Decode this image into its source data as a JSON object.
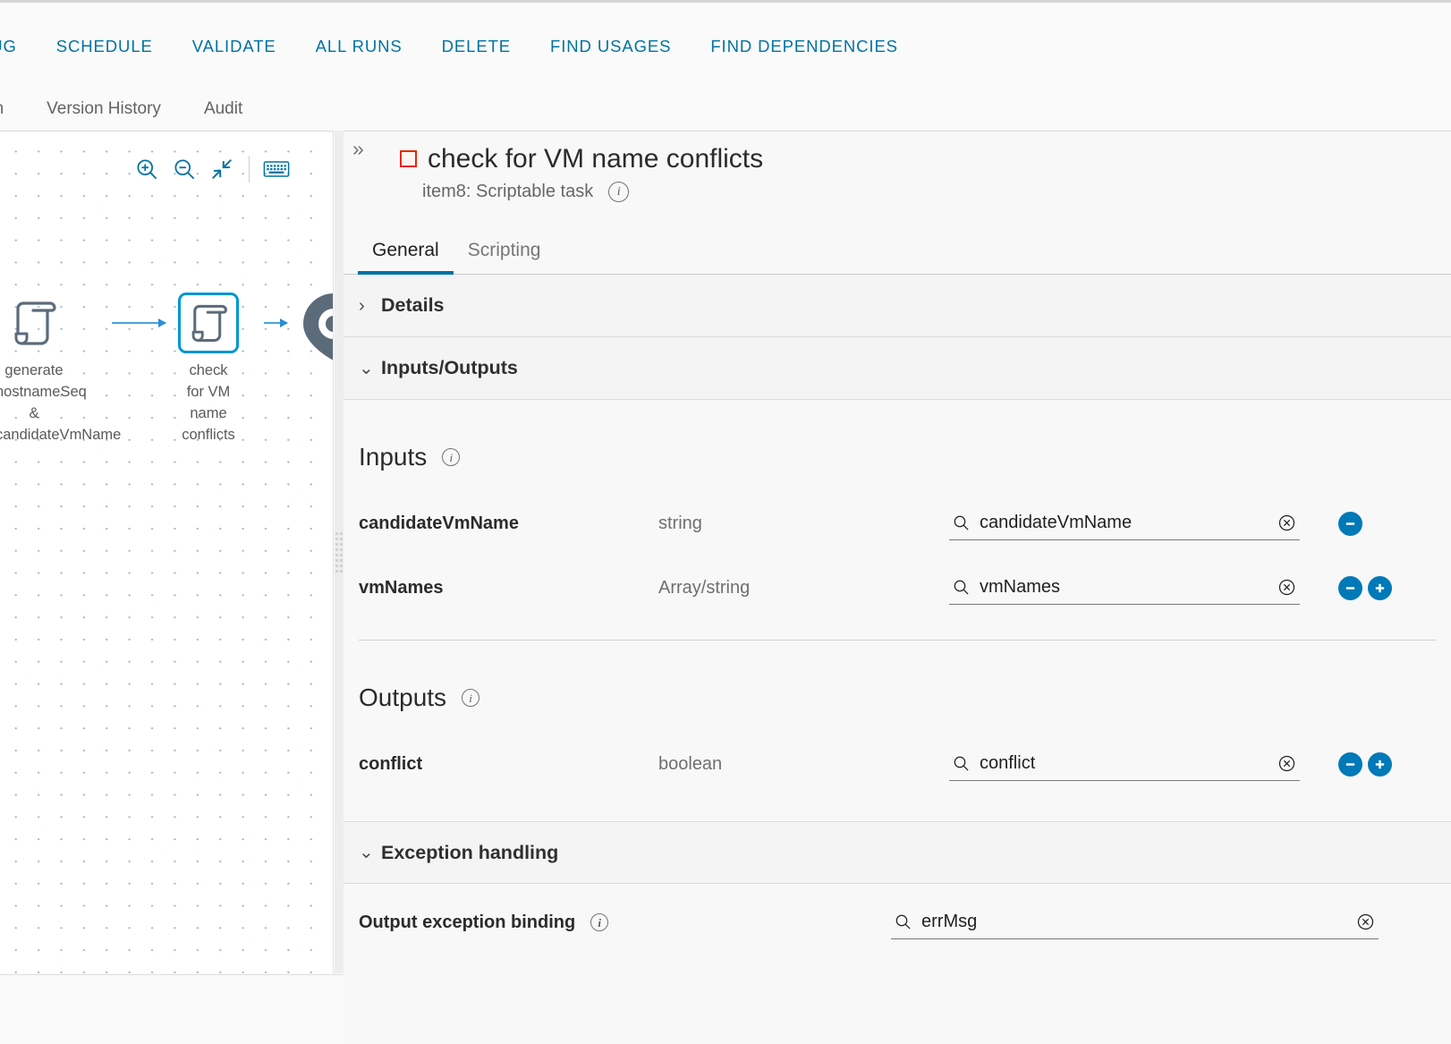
{
  "action_bar": {
    "links": [
      {
        "label": "BUG",
        "clipped": true
      },
      {
        "label": "SCHEDULE",
        "clipped": false
      },
      {
        "label": "VALIDATE",
        "clipped": false
      },
      {
        "label": "ALL RUNS",
        "clipped": false
      },
      {
        "label": "DELETE",
        "clipped": false
      },
      {
        "label": "FIND USAGES",
        "clipped": false
      },
      {
        "label": "FIND DEPENDENCIES",
        "clipped": false
      }
    ]
  },
  "sub_tabs": {
    "items": [
      {
        "label": "rm",
        "clipped": true
      },
      {
        "label": "Version History",
        "clipped": false
      },
      {
        "label": "Audit",
        "clipped": false
      }
    ]
  },
  "canvas": {
    "toolbar": [
      {
        "name": "zoom-in-icon",
        "title": "Zoom in"
      },
      {
        "name": "zoom-out-icon",
        "title": "Zoom out"
      },
      {
        "name": "fit-to-screen-icon",
        "title": "Fit to screen"
      },
      {
        "name": "keyboard-shortcuts-icon",
        "title": "Keyboard shortcuts"
      }
    ],
    "nodes": [
      {
        "id": "generate",
        "label": "generate\nhostnameSeq &\ncandidateVmName",
        "selected": false
      },
      {
        "id": "check",
        "label": "check\nfor VM\nname\nconflicts",
        "selected": true
      }
    ],
    "end_node": {
      "name": "end-node-icon"
    }
  },
  "details": {
    "title": "check for VM name conflicts",
    "subtitle": "item8: Scriptable task",
    "collapse_glyph": "»",
    "tabs": [
      {
        "label": "General",
        "active": true
      },
      {
        "label": "Scripting",
        "active": false
      }
    ],
    "sections": [
      {
        "id": "details",
        "label": "Details",
        "expanded": false,
        "chevron": "›"
      },
      {
        "id": "inputs_outputs",
        "label": "Inputs/Outputs",
        "expanded": true,
        "chevron": "⌄"
      },
      {
        "id": "exception_handling",
        "label": "Exception handling",
        "expanded": true,
        "chevron": "⌄"
      }
    ],
    "inputs": {
      "heading": "Inputs",
      "rows": [
        {
          "name": "candidateVmName",
          "type": "string",
          "value": "candidateVmName",
          "has_remove": true,
          "has_add": false
        },
        {
          "name": "vmNames",
          "type": "Array/string",
          "value": "vmNames",
          "has_remove": true,
          "has_add": true
        }
      ]
    },
    "outputs": {
      "heading": "Outputs",
      "rows": [
        {
          "name": "conflict",
          "type": "boolean",
          "value": "conflict",
          "has_remove": true,
          "has_add": true
        }
      ]
    },
    "exception": {
      "label": "Output exception binding",
      "value": "errMsg"
    }
  },
  "colors": {
    "accent_blue": "#0072a3",
    "link_blue": "#0079b8",
    "node_blue": "#0095d3",
    "error_red": "#e62700",
    "panel_bg": "#f8f8f8",
    "canvas_bg": "#ffffff"
  }
}
